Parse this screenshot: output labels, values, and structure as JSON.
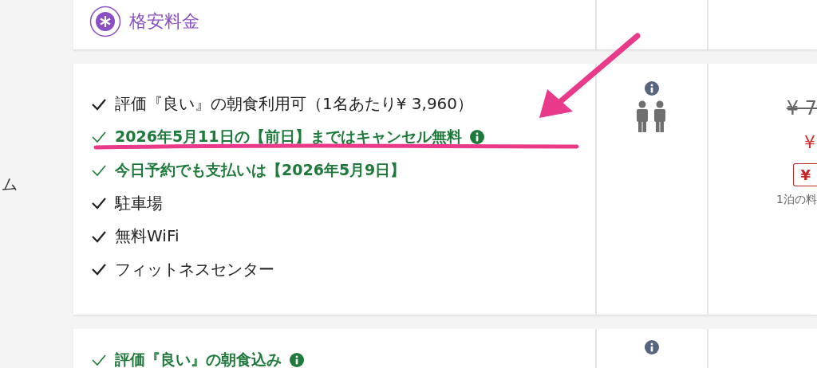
{
  "sidebar": {
    "text": "ム"
  },
  "rate_header": {
    "label": "格安料金"
  },
  "room_offer": {
    "features": [
      {
        "text": "評価『良い』の朝食利用可（1名あたり¥ 3,960）",
        "kind": "plain",
        "info": false
      },
      {
        "text": "2026年5月11日の【前日】まではキャンセル無料",
        "kind": "highlight",
        "info": true
      },
      {
        "text": "今日予約でも支払いは【2026年5月9日】",
        "kind": "highlight",
        "info": false
      },
      {
        "text": "駐車場",
        "kind": "plain",
        "info": false
      },
      {
        "text": "無料WiFi",
        "kind": "plain",
        "info": false
      },
      {
        "text": "フィットネスセンター",
        "kind": "plain",
        "info": false
      }
    ],
    "occupancy": {
      "info": true
    },
    "price": {
      "original": "¥ 7",
      "current": "¥",
      "badge": "¥",
      "note": "1泊の料"
    }
  },
  "annotations": {
    "arrow": true,
    "underline": true
  },
  "next_offer": {
    "features": [
      {
        "text": "評価『良い』の朝食込み",
        "kind": "highlight",
        "info": true
      }
    ],
    "occupancy": {
      "info": true
    }
  }
}
